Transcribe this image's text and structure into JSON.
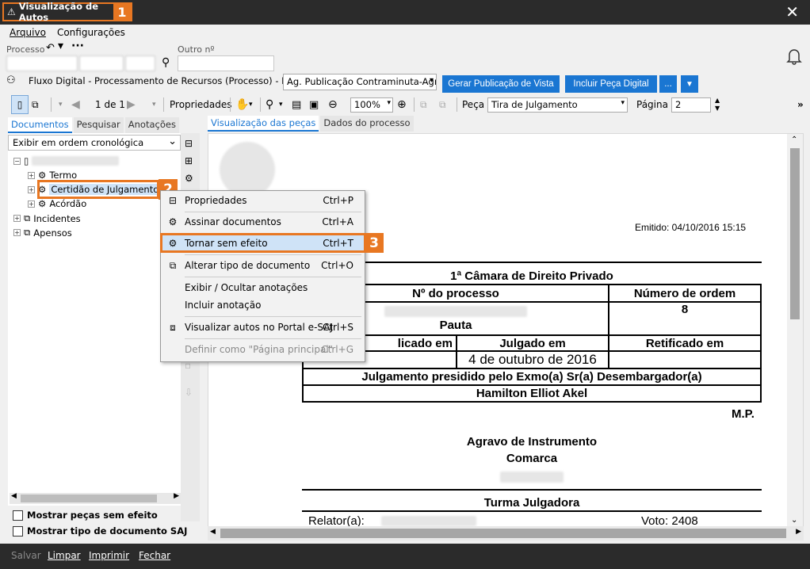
{
  "window": {
    "title": "Visualização de Autos",
    "callout_1": "1"
  },
  "menu": {
    "arquivo": "Arquivo",
    "configuracoes": "Configurações"
  },
  "process": {
    "processo_label": "Processo",
    "outro_label": "Outro nº"
  },
  "fluxo": {
    "text": "Fluxo Digital - Processamento de Recursos (Processo) - Fila:",
    "fila_value": "Ag. Publicação Contraminuta-Agr",
    "btn_gerar": "Gerar Publicação de Vista",
    "btn_incluir": "Incluir Peça Digital",
    "btn_more": "..."
  },
  "toolbar": {
    "page_of": "1 de 1",
    "propriedades": "Propriedades",
    "zoom": "100%",
    "peca_label": "Peça",
    "peca_value": "Tira de Julgamento",
    "pagina_label": "Página",
    "pagina_value": "2"
  },
  "left": {
    "tabs": [
      "Documentos",
      "Pesquisar",
      "Anotações"
    ],
    "order": "Exibir em ordem cronológica",
    "tree": {
      "termo": "Termo",
      "certidao": "Certidão de Julgamento",
      "acordao": "Acórdão",
      "incidentes": "Incidentes",
      "apensos": "Apensos"
    },
    "callout_2": "2",
    "chk_sem_efeito": "Mostrar peças sem efeito",
    "chk_tipo_doc": "Mostrar tipo de documento SAJ"
  },
  "right": {
    "tabs": [
      "Visualização das peças",
      "Dados do processo"
    ]
  },
  "document": {
    "emitido": "Emitido: 04/10/2016 15:15",
    "camara": "1ª Câmara de Direito Privado",
    "num_processo_h": "Nº do processo",
    "num_ordem_h": "Número de ordem",
    "num_ordem": "8",
    "pauta": "Pauta",
    "publicado_em": "licado em",
    "julgado_em": "Julgado em",
    "retificado_em": "Retificado em",
    "julgado_date": "4 de outubro de 2016",
    "presidido": "Julgamento presidido pelo Exmo(a) Sr(a) Desembargador(a)",
    "desembargador": "Hamilton Elliot Akel",
    "mp": "M.P.",
    "agravo": "Agravo de Instrumento",
    "comarca": "Comarca",
    "turma": "Turma Julgadora",
    "relator": "Relator(a):",
    "voto": "Voto: 2408"
  },
  "context_menu": {
    "items": [
      {
        "label": "Propriedades",
        "shortcut": "Ctrl+P"
      },
      {
        "label": "Assinar documentos",
        "shortcut": "Ctrl+A"
      },
      {
        "label": "Tornar sem efeito",
        "shortcut": "Ctrl+T"
      },
      {
        "label": "Alterar tipo de documento",
        "shortcut": "Ctrl+O"
      },
      {
        "label": "Exibir / Ocultar anotações",
        "shortcut": ""
      },
      {
        "label": "Incluir anotação",
        "shortcut": ""
      },
      {
        "label": "Visualizar autos no Portal e-SAJ",
        "shortcut": "Ctrl+S"
      },
      {
        "label": "Definir como \"Página principal\"",
        "shortcut": "Ctrl+G"
      }
    ],
    "callout_3": "3"
  },
  "bottom": {
    "salvar": "Salvar",
    "limpar": "Limpar",
    "imprimir": "Imprimir",
    "fechar": "Fechar"
  }
}
